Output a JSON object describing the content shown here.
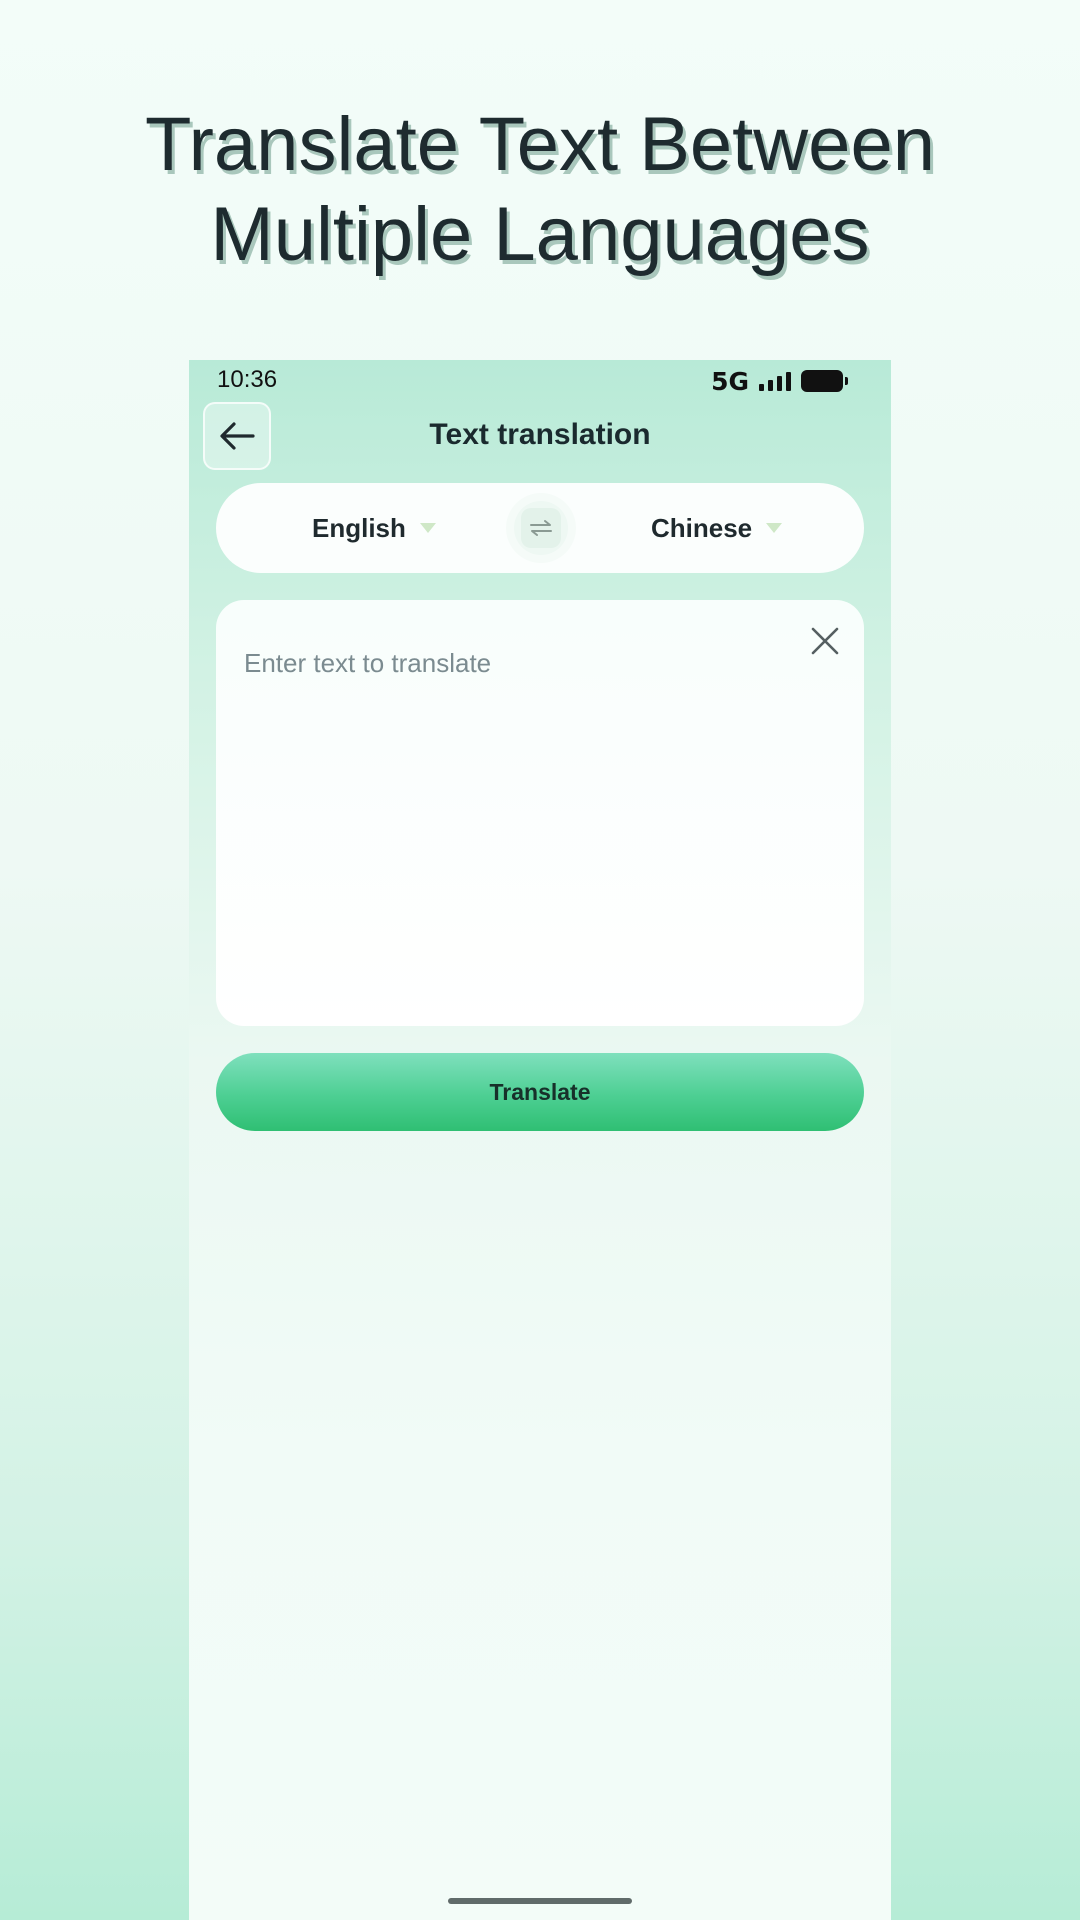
{
  "promo": {
    "headline_line1": "Translate Text Between",
    "headline_line2": "Multiple Languages"
  },
  "status_bar": {
    "time": "10:36",
    "network": "5G",
    "icons": [
      "signal-icon",
      "battery-icon"
    ]
  },
  "nav": {
    "back_icon": "arrow-left-icon",
    "title": "Text translation"
  },
  "languages": {
    "source": "English",
    "target": "Chinese",
    "swap_icon": "swap-arrows-icon",
    "dropdown_icon": "caret-down-icon"
  },
  "input": {
    "placeholder": "Enter text to translate",
    "value": "",
    "clear_icon": "close-icon"
  },
  "actions": {
    "translate_label": "Translate"
  },
  "colors": {
    "accent": "#2fbf73",
    "accent_light": "#7fe0bd",
    "text_dark": "#1f2a2e",
    "placeholder": "#7b8b90"
  }
}
